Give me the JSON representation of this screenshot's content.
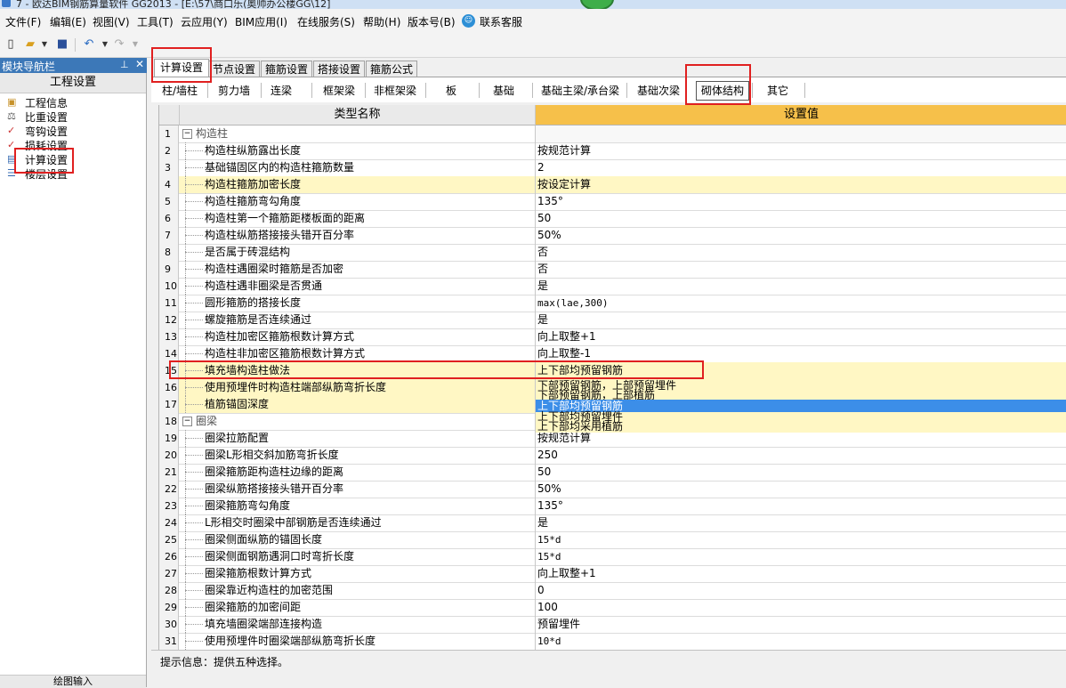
{
  "title": {
    "text": "7 - 欧达BIM钢筋算量软件 GG2013 - [E:\\57\\商口乐(奥帅办公楼GG\\12]"
  },
  "menu": {
    "items": [
      "文件(F)",
      "编辑(E)",
      "视图(V)",
      "工具(T)",
      "云应用(Y)",
      "BIM应用(I)",
      "在线服务(S)",
      "帮助(H)",
      "版本号(B)"
    ],
    "service": "联系客服"
  },
  "nav": {
    "header": "模块导航栏",
    "title": "工程设置",
    "items": [
      "工程信息",
      "比重设置",
      "弯钩设置",
      "损耗设置",
      "计算设置",
      "楼层设置"
    ],
    "footer": "绘图输入"
  },
  "tabs": [
    "计算设置",
    "节点设置",
    "箍筋设置",
    "搭接设置",
    "箍筋公式"
  ],
  "subtabs": [
    "柱/墙柱",
    "剪力墙",
    "连梁",
    "框架梁",
    "非框架梁",
    "板",
    "基础",
    "基础主梁/承台梁",
    "基础次梁",
    "砌体结构",
    "其它"
  ],
  "grid": {
    "col_name": "类型名称",
    "col_value": "设置值",
    "rows": [
      {
        "n": "1",
        "name": "构造柱",
        "value": ""
      },
      {
        "n": "2",
        "name": "构造柱纵筋露出长度",
        "value": "按规范计算"
      },
      {
        "n": "3",
        "name": "基础锚固区内的构造柱箍筋数量",
        "value": "2"
      },
      {
        "n": "4",
        "name": "构造柱箍筋加密长度",
        "value": "按设定计算"
      },
      {
        "n": "5",
        "name": "构造柱箍筋弯勾角度",
        "value": "135°"
      },
      {
        "n": "6",
        "name": "构造柱第一个箍筋距楼板面的距离",
        "value": "50"
      },
      {
        "n": "7",
        "name": "构造柱纵筋搭接接头错开百分率",
        "value": "50%"
      },
      {
        "n": "8",
        "name": "是否属于砖混结构",
        "value": "否"
      },
      {
        "n": "9",
        "name": "构造柱遇圈梁时箍筋是否加密",
        "value": "否"
      },
      {
        "n": "10",
        "name": "构造柱遇非圈梁是否贯通",
        "value": "是"
      },
      {
        "n": "11",
        "name": "圆形箍筋的搭接长度",
        "value": "max(lae,300)"
      },
      {
        "n": "12",
        "name": "螺旋箍筋是否连续通过",
        "value": "是"
      },
      {
        "n": "13",
        "name": "构造柱加密区箍筋根数计算方式",
        "value": "向上取整+1"
      },
      {
        "n": "14",
        "name": "构造柱非加密区箍筋根数计算方式",
        "value": "向上取整-1"
      },
      {
        "n": "15",
        "name": "填充墙构造柱做法",
        "value": "上下部均预留钢筋"
      },
      {
        "n": "16",
        "name": "使用预埋件时构造柱端部纵筋弯折长度",
        "value": ""
      },
      {
        "n": "17",
        "name": "植筋锚固深度",
        "value": ""
      },
      {
        "n": "18",
        "name": "圈梁",
        "value": ""
      },
      {
        "n": "19",
        "name": "圈梁拉筋配置",
        "value": "按规范计算"
      },
      {
        "n": "20",
        "name": "圈梁L形相交斜加筋弯折长度",
        "value": "250"
      },
      {
        "n": "21",
        "name": "圈梁箍筋距构造柱边缘的距离",
        "value": "50"
      },
      {
        "n": "22",
        "name": "圈梁纵筋搭接接头错开百分率",
        "value": "50%"
      },
      {
        "n": "23",
        "name": "圈梁箍筋弯勾角度",
        "value": "135°"
      },
      {
        "n": "24",
        "name": "L形相交时圈梁中部钢筋是否连续通过",
        "value": "是"
      },
      {
        "n": "25",
        "name": "圈梁侧面纵筋的锚固长度",
        "value": "15*d"
      },
      {
        "n": "26",
        "name": "圈梁侧面钢筋遇洞口时弯折长度",
        "value": "15*d"
      },
      {
        "n": "27",
        "name": "圈梁箍筋根数计算方式",
        "value": "向上取整+1"
      },
      {
        "n": "28",
        "name": "圈梁靠近构造柱的加密范围",
        "value": "0"
      },
      {
        "n": "29",
        "name": "圈梁箍筋的加密间距",
        "value": "100"
      },
      {
        "n": "30",
        "name": "填充墙圈梁端部连接构造",
        "value": "预留埋件"
      },
      {
        "n": "31",
        "name": "使用预埋件时圈梁端部纵筋弯折长度",
        "value": "10*d"
      }
    ]
  },
  "dropdown": {
    "options": [
      "下部预留钢筋，上部预留埋件",
      "下部预留钢筋，上部植筋",
      "上下部均预留钢筋",
      "上下部均预留埋件",
      "上下部均采用植筋"
    ],
    "selected_index": 2
  },
  "status": {
    "text": "提示信息：提供五种选择。"
  },
  "colors": {
    "selected_row": "#fff7c4",
    "header_value": "#f6c04a",
    "highlight": "#3c8ee8",
    "annotation": "#e02020"
  }
}
